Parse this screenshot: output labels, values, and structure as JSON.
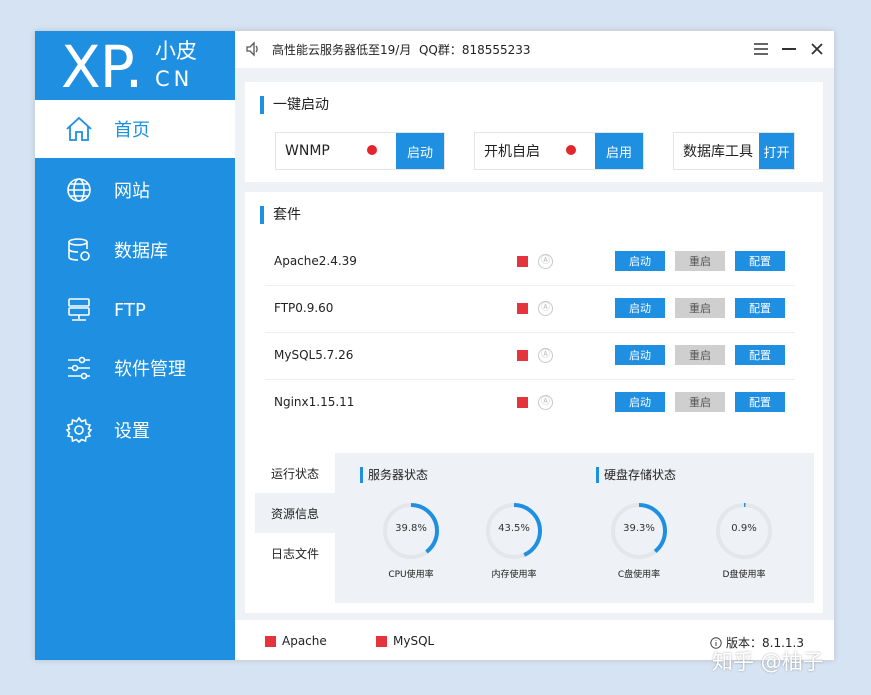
{
  "logo": {
    "xp": "XP",
    "dot": ".",
    "xiao": "小皮",
    "cn": "CN"
  },
  "sidebar": {
    "items": [
      {
        "label": "首页",
        "icon": "home-icon",
        "active": true
      },
      {
        "label": "网站",
        "icon": "globe-icon"
      },
      {
        "label": "数据库",
        "icon": "database-icon"
      },
      {
        "label": "FTP",
        "icon": "server-icon"
      },
      {
        "label": "软件管理",
        "icon": "sliders-icon"
      },
      {
        "label": "设置",
        "icon": "gear-icon"
      }
    ]
  },
  "titlebar": {
    "notice": "高性能云服务器低至19/月  QQ群：818555233"
  },
  "quickstart": {
    "title": "一键启动",
    "items": [
      {
        "label": "WNMP",
        "button": "启动",
        "status": "stopped"
      },
      {
        "label": "开机自启",
        "button": "启用",
        "status": "off"
      },
      {
        "label": "数据库工具",
        "button": "打开"
      }
    ]
  },
  "suite": {
    "title": "套件",
    "auto_glyph": "Ⓐ",
    "buttons": {
      "start": "启动",
      "restart": "重启",
      "config": "配置"
    },
    "rows": [
      {
        "name": "Apache2.4.39"
      },
      {
        "name": "FTP0.9.60"
      },
      {
        "name": "MySQL5.7.26"
      },
      {
        "name": "Nginx1.15.11"
      }
    ]
  },
  "info": {
    "tabs": [
      "运行状态",
      "资源信息",
      "日志文件"
    ],
    "active_tab": 1,
    "server_title": "服务器状态",
    "disk_title": "硬盘存储状态",
    "gauges": [
      {
        "value": 39.8,
        "text": "39.8%",
        "label": "CPU使用率"
      },
      {
        "value": 43.5,
        "text": "43.5%",
        "label": "内存使用率"
      },
      {
        "value": 39.3,
        "text": "39.3%",
        "label": "C盘使用率"
      },
      {
        "value": 0.9,
        "text": "0.9%",
        "label": "D盘使用率"
      }
    ]
  },
  "statusbar": {
    "legend": [
      "Apache",
      "MySQL"
    ],
    "version": "版本：8.1.1.3"
  },
  "watermark": "知乎 @柚子",
  "colors": {
    "accent": "#1e8fe1",
    "stopped": "#e3353b",
    "gauge_track": "#e3e6ea"
  }
}
